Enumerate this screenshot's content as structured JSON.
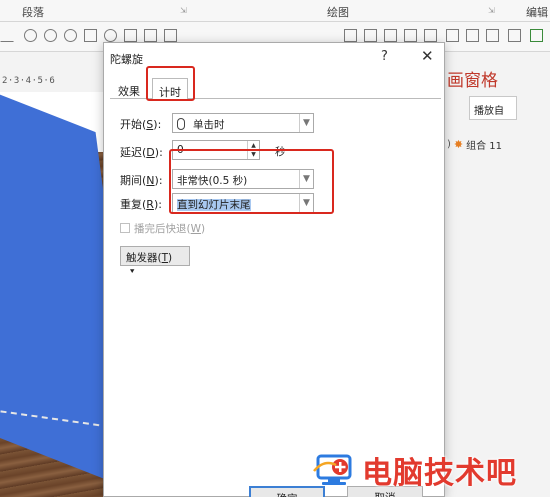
{
  "ribbon": {
    "group_paragraph": "段落",
    "group_drawing": "绘图",
    "group_edit": "编辑"
  },
  "ruler": {
    "text": "2·3·4·5·6"
  },
  "animation_pane": {
    "title": "画窗格",
    "play_from": "播放自",
    "item_label": "组合 11"
  },
  "dialog": {
    "title": "陀螺旋",
    "help": "?",
    "close": "✕",
    "tabs": [
      {
        "label": "效果"
      },
      {
        "label": "计时"
      }
    ],
    "fields": {
      "start": {
        "label": "开始(",
        "key": "S",
        "suffix": "):",
        "value": "单击时"
      },
      "delay": {
        "label": "延迟(",
        "key": "D",
        "suffix": "):",
        "value": "0",
        "unit": "秒"
      },
      "period": {
        "label": "期间(",
        "key": "N",
        "suffix": "):",
        "value": "非常快(0.5 秒)"
      },
      "repeat": {
        "label": "重复(",
        "key": "R",
        "suffix": "):",
        "value": "直到幻灯片末尾"
      }
    },
    "rewind": {
      "label": "播完后快退(",
      "key": "W",
      "suffix": ")"
    },
    "trigger": {
      "label": "触发器(",
      "key": "T",
      "suffix": ")"
    },
    "buttons": {
      "ok": "确定",
      "cancel": "取消"
    }
  },
  "watermark": {
    "text": "电脑技术吧"
  }
}
